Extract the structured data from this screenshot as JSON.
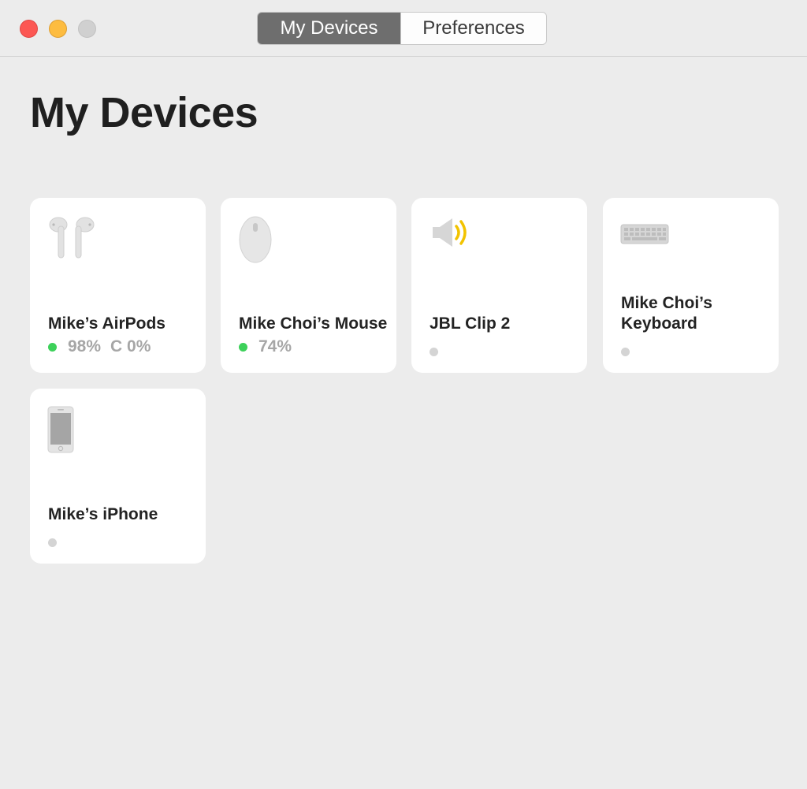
{
  "toolbar": {
    "tabs": [
      {
        "label": "My Devices",
        "active": true
      },
      {
        "label": "Preferences",
        "active": false
      }
    ]
  },
  "page": {
    "title": "My Devices"
  },
  "devices": [
    {
      "name": "Mike’s AirPods",
      "icon": "airpods-icon",
      "status": "connected",
      "battery": "98%",
      "case_battery": "C 0%"
    },
    {
      "name": "Mike Choi’s Mouse",
      "icon": "mouse-icon",
      "status": "connected",
      "battery": "74%"
    },
    {
      "name": "JBL Clip 2",
      "icon": "speaker-icon",
      "status": "disconnected"
    },
    {
      "name": "Mike Choi’s Keyboard",
      "icon": "keyboard-icon",
      "status": "disconnected"
    },
    {
      "name": "Mike’s iPhone",
      "icon": "iphone-icon",
      "status": "disconnected"
    }
  ],
  "colors": {
    "connected": "#3dd15a",
    "disconnected": "#d4d4d4",
    "speaker_accent": "#f2c300",
    "active_tab": "#6e6e6e"
  }
}
